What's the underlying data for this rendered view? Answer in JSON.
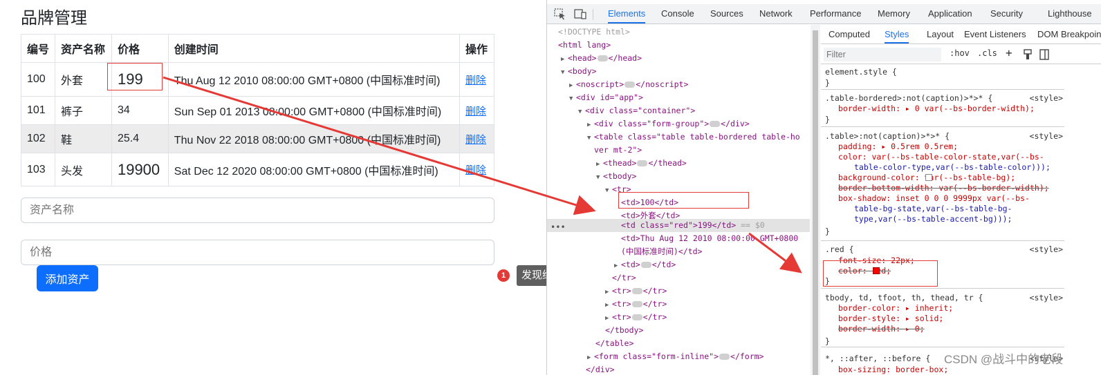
{
  "app": {
    "title": "品牌管理",
    "table": {
      "headers": [
        "编号",
        "资产名称",
        "价格",
        "创建时间",
        "操作"
      ],
      "rows": [
        {
          "id": "100",
          "name": "外套",
          "price": "199",
          "created": "Thu Aug 12 2010 08:00:00 GMT+0800 (中国标准时间)",
          "action": "删除"
        },
        {
          "id": "101",
          "name": "裤子",
          "price": "34",
          "created": "Sun Sep 01 2013 08:00:00 GMT+0800 (中国标准时间)",
          "action": "删除"
        },
        {
          "id": "102",
          "name": "鞋",
          "price": "25.4",
          "created": "Thu Nov 22 2018 08:00:00 GMT+0800 (中国标准时间)",
          "action": "删除"
        },
        {
          "id": "103",
          "name": "头发",
          "price": "19900",
          "created": "Sat Dec 12 2020 08:00:00 GMT+0800 (中国标准时间)",
          "action": "删除"
        }
      ]
    },
    "name_input_placeholder": "资产名称",
    "price_input_placeholder": "价格",
    "add_button": "添加资产"
  },
  "annotation": {
    "number": "1",
    "text": "发现给td添加文字颜色  加不上"
  },
  "devtools": {
    "tabs": [
      "Elements",
      "Console",
      "Sources",
      "Network",
      "Performance",
      "Memory",
      "Application",
      "Security",
      "Lighthouse"
    ],
    "active_tab": "Elements",
    "dom": {
      "doctype": "<!DOCTYPE html>",
      "html_open": "<html lang>",
      "head": "<head>",
      "head_close": "</head>",
      "body": "<body>",
      "noscript": "<noscript>",
      "noscript_close": "</noscript>",
      "div_app": "<div id=\"app\">",
      "div_container": "<div class=\"container\">",
      "div_form_group": "<div class=\"form-group\">",
      "div_close": "</div>",
      "table_open_1": "<table class=\"table table-bordered table-ho",
      "table_open_2": "ver mt-2\">",
      "thead": "<thead>",
      "thead_close": "</thead>",
      "tbody": "<tbody>",
      "tr": "<tr>",
      "td_100": "<td>100</td>",
      "td_coat": "<td>外套</td>",
      "td_red": "<td class=\"red\">199</td>",
      "eq_sel": "== $0",
      "td_date_1": "<td>Thu Aug 12 2010 08:00:00 GMT+0800",
      "td_date_2": "(中国标准时间)</td>",
      "td_collapsed": "<td>",
      "td_collapsed_close": "</td>",
      "tr_close": "</tr>",
      "tbody_close": "</tbody>",
      "table_close": "</table>",
      "form_inline": "<form class=\"form-inline\">",
      "form_close": "</form>",
      "div_close_end": "</div>"
    },
    "styles_tabs": [
      "Computed",
      "Styles",
      "Layout",
      "Event Listeners",
      "DOM Breakpoints"
    ],
    "styles_active": "Styles",
    "filter_placeholder": "Filter",
    "filter_hov": ":hov",
    "filter_cls": ".cls",
    "rules": {
      "r1_selector": "element.style {",
      "r2_selector": ".table-bordered>:not(caption)>*>* {",
      "r2_source": "<style>",
      "r2_decl": "border-width: ▸ 0 var(--bs-border-width);",
      "r3_selector": ".table>:not(caption)>*>* {",
      "r3_source": "<style>",
      "r3_l1": "padding: ▸ 0.5rem 0.5rem;",
      "r3_l2": "color: var(--bs-table-color-state,var(--bs-",
      "r3_l3": "table-color-type,var(--bs-table-color)));",
      "r3_l4": "background-color: var(--bs-table-bg);",
      "r3_l5": "border-bottom-width: var(--bs-border-width);",
      "r3_l6": "box-shadow: inset 0 0 0 9999px var(--bs-",
      "r3_l7": "table-bg-state,var(--bs-table-bg-",
      "r3_l8": "type,var(--bs-table-accent-bg)));",
      "r4_selector": ".red {",
      "r4_source": "<style>",
      "r4_l1": "font-size: 22px;",
      "r4_l2": "color: red;",
      "r5_selector": "tbody, td, tfoot, th, thead, tr {",
      "r5_source": "<style>",
      "r5_l1": "border-color: ▸ inherit;",
      "r5_l2": "border-style: ▸ solid;",
      "r5_l3": "border-width: ▸ 0;",
      "r6_selector": "*, ::after, ::before {",
      "r6_source": "<style>",
      "r6_l1": "box-sizing: border-box;",
      "close": "}"
    }
  },
  "watermark": "CSDN @战斗中的老段",
  "colors": {
    "accent": "#1a73e8",
    "button": "#0d6efd",
    "highlight": "#e53935",
    "red_swatch": "#ff0000"
  }
}
